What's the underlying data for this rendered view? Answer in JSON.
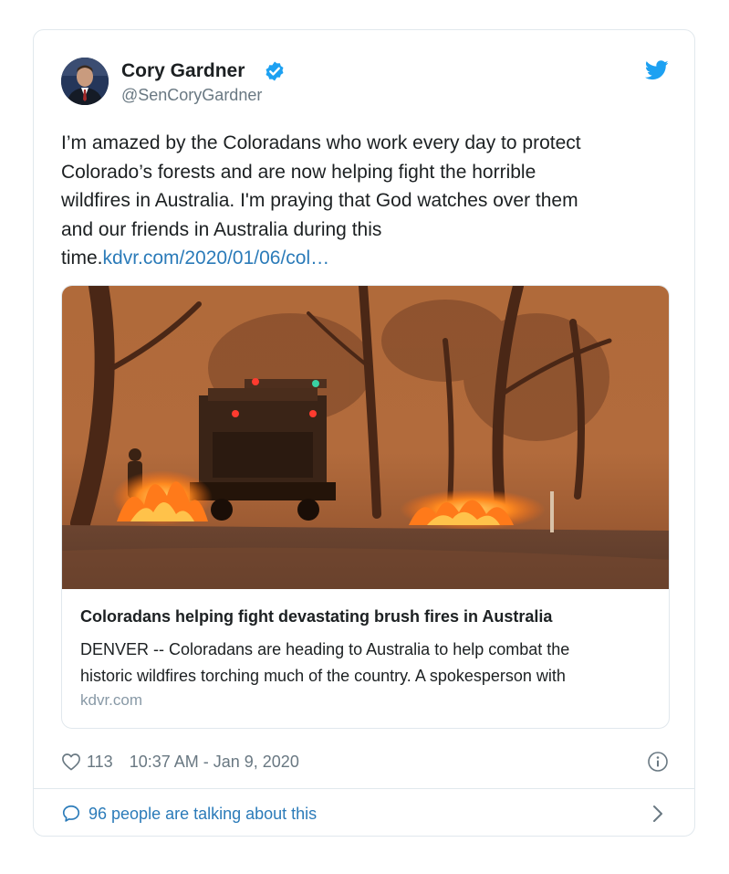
{
  "author": {
    "name": "Cory Gardner",
    "handle": "@SenCoryGardner",
    "verified": true
  },
  "tweet": {
    "text_lines": [
      "I’m amazed by the Coloradans who work every day to protect",
      "Colorado’s forests and are now helping fight the horrible",
      "wildfires in Australia. I'm praying that God watches over them",
      "and our friends in Australia during this"
    ],
    "text_last": "time.",
    "link": "kdvr.com/2020/01/06/col…"
  },
  "card": {
    "title": "Coloradans helping fight devastating brush fires in Australia",
    "description_lines": [
      "DENVER -- Coloradans are heading to Australia to help combat the",
      "historic wildfires torching much of the country. A spokesperson with"
    ],
    "domain": "kdvr.com"
  },
  "meta": {
    "likes": "113",
    "timestamp": "10:37 AM - Jan 9, 2020"
  },
  "footer": {
    "talking": "96 people are talking about this"
  },
  "icons": {
    "verified": "verified-badge-icon",
    "brand": "twitter-bird-icon",
    "like": "heart-icon",
    "info": "info-icon",
    "reply": "speech-bubble-icon",
    "more": "chevron-right-icon"
  },
  "colors": {
    "link": "#2b7bb9",
    "verified": "#1da1f2",
    "brand": "#1da1f2",
    "muted": "#697882"
  }
}
